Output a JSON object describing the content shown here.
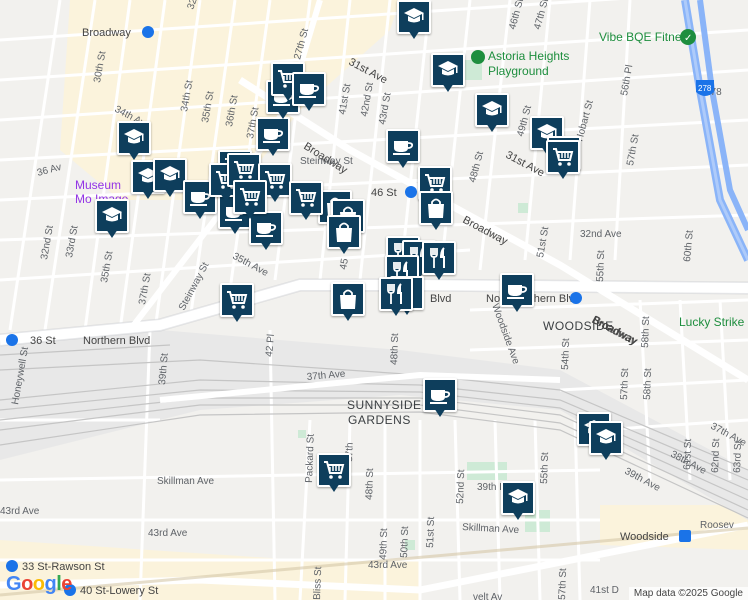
{
  "attribution": "Map data ©2025 Google",
  "logo": "Google",
  "colors": {
    "marker": "#0e3e5c",
    "transit": "#1a73e8",
    "park": "#1e8e3e",
    "museum": "#9334e6",
    "highway": "#8ab4f8"
  },
  "neighborhoods": {
    "woodside": "WOODSIDE",
    "sunnyside_1": "SUNNYSIDE",
    "sunnyside_2": "GARDENS"
  },
  "pois": {
    "vibe": "Vibe BQE Fitness",
    "astoria_1": "Astoria Heights",
    "astoria_2": "Playground",
    "lucky": "Lucky Strike",
    "museum_1": "Museum",
    "museum_2": "Mo       Image"
  },
  "stations": {
    "broadway": "Broadway",
    "s46": "46 St",
    "northern": "Northern Blvd",
    "s36": "36 St",
    "woodside": "Woodside",
    "rawson": "33 St-Rawson St",
    "lowery": "40 St-Lowery St"
  },
  "roads": {
    "broadway_nw": "Broadway",
    "broadway_mid": "Broadway",
    "broadway_se": "Broadway",
    "northern_w": "Northern Blvd",
    "northern_c": "Blvd",
    "northern_e": "No      Blvd",
    "ave31": "31st Ave",
    "ave31_e": "31st Ave",
    "ave32": "32nd Ave",
    "ave34": "34th Ave",
    "ave35": "35th Ave",
    "ave36": "36 Av",
    "ave37": "37th Ave",
    "ave37_e": "37th Ave",
    "ave38": "38th Ave",
    "ave39": "39th Ave",
    "ave39d": "39th D",
    "skillman_w": "Skillman Ave",
    "skillman_e": "Skillman Ave",
    "ave43": "43rd Ave",
    "ave43_2": "43rd Ave",
    "roosevelt": "Roosev",
    "roosevelt_2": "velt Av",
    "steinway_1": "Steinway St",
    "steinway_2": "Steinway St",
    "woodside_ave": "Woodside Ave",
    "woodside_bway": "Broadway",
    "hobart": "Hobart St",
    "honeywell": "Honeywell St",
    "st30": "30th St",
    "st34": "34th St",
    "st35": "35th St",
    "st36": "36th St",
    "st37": "37th St",
    "st32nd": "32nd St",
    "st33rd": "33rd St",
    "st35b": "35th St",
    "st37b": "37th St",
    "st39": "39th St",
    "st41": "41st St",
    "st42": "42nd St",
    "st43": "43rd St",
    "st42pl": "42 Pl",
    "st46": "46th St",
    "st47": "47th St",
    "st48": "48th St",
    "st48b": "48th St",
    "st49": "49th St",
    "st49b": "49th St",
    "st50": "50th St",
    "st51": "51st St",
    "st51b": "51st St",
    "st52": "52nd St",
    "st54": "54th St",
    "st55": "55th St",
    "st55b": "55th St",
    "st56pl": "56th Pl",
    "st57": "57th St",
    "st57b": "57th St",
    "st57c": "57th St",
    "st58": "58th St",
    "st58b": "58th St",
    "st60": "60th St",
    "st61": "61st St",
    "st62": "62nd St",
    "st63": "63rd St",
    "st41d": "41st D",
    "packard": "Packard St",
    "bliss": "Bliss St",
    "st32": "32",
    "st27": "27th St",
    "st45": "45",
    "st47b": "47th St",
    "st44": "44th St",
    "st50b": "50",
    "st55c": "55th St",
    "st60b": "60",
    "st37c": "37th",
    "i278": "278"
  },
  "markers": [
    {
      "type": "school"
    },
    {
      "type": "school"
    },
    {
      "type": "school"
    },
    {
      "type": "school"
    },
    {
      "type": "school"
    },
    {
      "type": "grocery"
    },
    {
      "type": "coffee"
    },
    {
      "type": "coffee"
    },
    {
      "type": "coffee"
    },
    {
      "type": "school"
    },
    {
      "type": "school"
    },
    {
      "type": "school"
    },
    {
      "type": "grocery"
    },
    {
      "type": "grocery"
    },
    {
      "type": "coffee"
    },
    {
      "type": "coffee"
    },
    {
      "type": "coffee"
    },
    {
      "type": "grocery"
    },
    {
      "type": "grocery"
    },
    {
      "type": "grocery"
    },
    {
      "type": "coffee"
    },
    {
      "type": "grocery"
    },
    {
      "type": "shopping"
    },
    {
      "type": "shopping"
    },
    {
      "type": "shopping"
    },
    {
      "type": "shopping"
    },
    {
      "type": "restaurant"
    },
    {
      "type": "restaurant"
    },
    {
      "type": "restaurant"
    },
    {
      "type": "restaurant"
    },
    {
      "type": "restaurant"
    },
    {
      "type": "grocery"
    },
    {
      "type": "grocery"
    },
    {
      "type": "grocery"
    },
    {
      "type": "shopping"
    },
    {
      "type": "restaurant"
    },
    {
      "type": "coffee"
    },
    {
      "type": "coffee"
    },
    {
      "type": "grocery"
    },
    {
      "type": "school"
    },
    {
      "type": "school"
    },
    {
      "type": "school"
    },
    {
      "type": "grocery"
    }
  ]
}
